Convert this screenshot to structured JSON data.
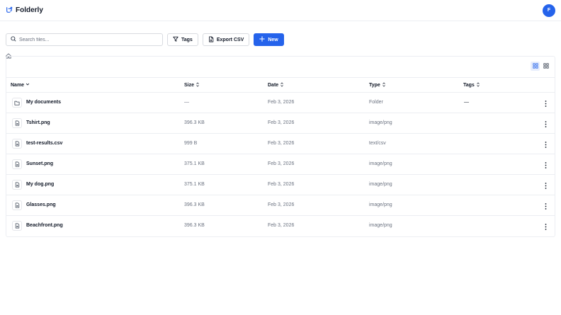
{
  "app": {
    "name": "Folderly",
    "avatar_initial": "F"
  },
  "toolbar": {
    "search_placeholder": "Search files...",
    "tags_label": "Tags",
    "export_label": "Export CSV",
    "new_label": "New"
  },
  "colors": {
    "accent": "#2563eb",
    "muted_text": "#6b7280",
    "border": "#eceef2"
  },
  "view_modes": [
    "list-view",
    "grid-view"
  ],
  "table": {
    "columns": {
      "name": "Name",
      "size": "Size",
      "date": "Date",
      "type": "Type",
      "tags": "Tags"
    },
    "rows": [
      {
        "name": "My documents",
        "size": "—",
        "date": "Feb 3, 2026",
        "type": "Folder",
        "tags": "—",
        "icon": "folder-icon"
      },
      {
        "name": "Tshirt.png",
        "size": "396.3 KB",
        "date": "Feb 3, 2026",
        "type": "image/png",
        "tags": "",
        "icon": "file-icon"
      },
      {
        "name": "test-results.csv",
        "size": "999 B",
        "date": "Feb 3, 2026",
        "type": "text/csv",
        "tags": "",
        "icon": "file-icon"
      },
      {
        "name": "Sunset.png",
        "size": "375.1 KB",
        "date": "Feb 3, 2026",
        "type": "image/png",
        "tags": "",
        "icon": "file-icon"
      },
      {
        "name": "My dog.png",
        "size": "375.1 KB",
        "date": "Feb 3, 2026",
        "type": "image/png",
        "tags": "",
        "icon": "file-icon"
      },
      {
        "name": "Glasses.png",
        "size": "396.3 KB",
        "date": "Feb 3, 2026",
        "type": "image/png",
        "tags": "",
        "icon": "file-icon"
      },
      {
        "name": "Beachfront.png",
        "size": "396.3 KB",
        "date": "Feb 3, 2026",
        "type": "image/png",
        "tags": "",
        "icon": "file-icon"
      }
    ]
  }
}
